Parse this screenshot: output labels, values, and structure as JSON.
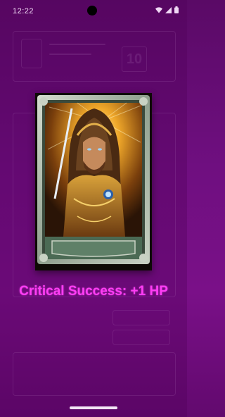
{
  "status_bar": {
    "time": "12:22",
    "icons": [
      "wifi-icon",
      "signal-icon",
      "battery-icon"
    ]
  },
  "background": {
    "counter_value": "10"
  },
  "card": {
    "subject": "hooded-warrior-card-art"
  },
  "result": {
    "text": "Critical Success: +1 HP"
  },
  "colors": {
    "background": "#6f0f80",
    "result_text": "#ff3df5",
    "card_frame": "#b7c3b6"
  }
}
